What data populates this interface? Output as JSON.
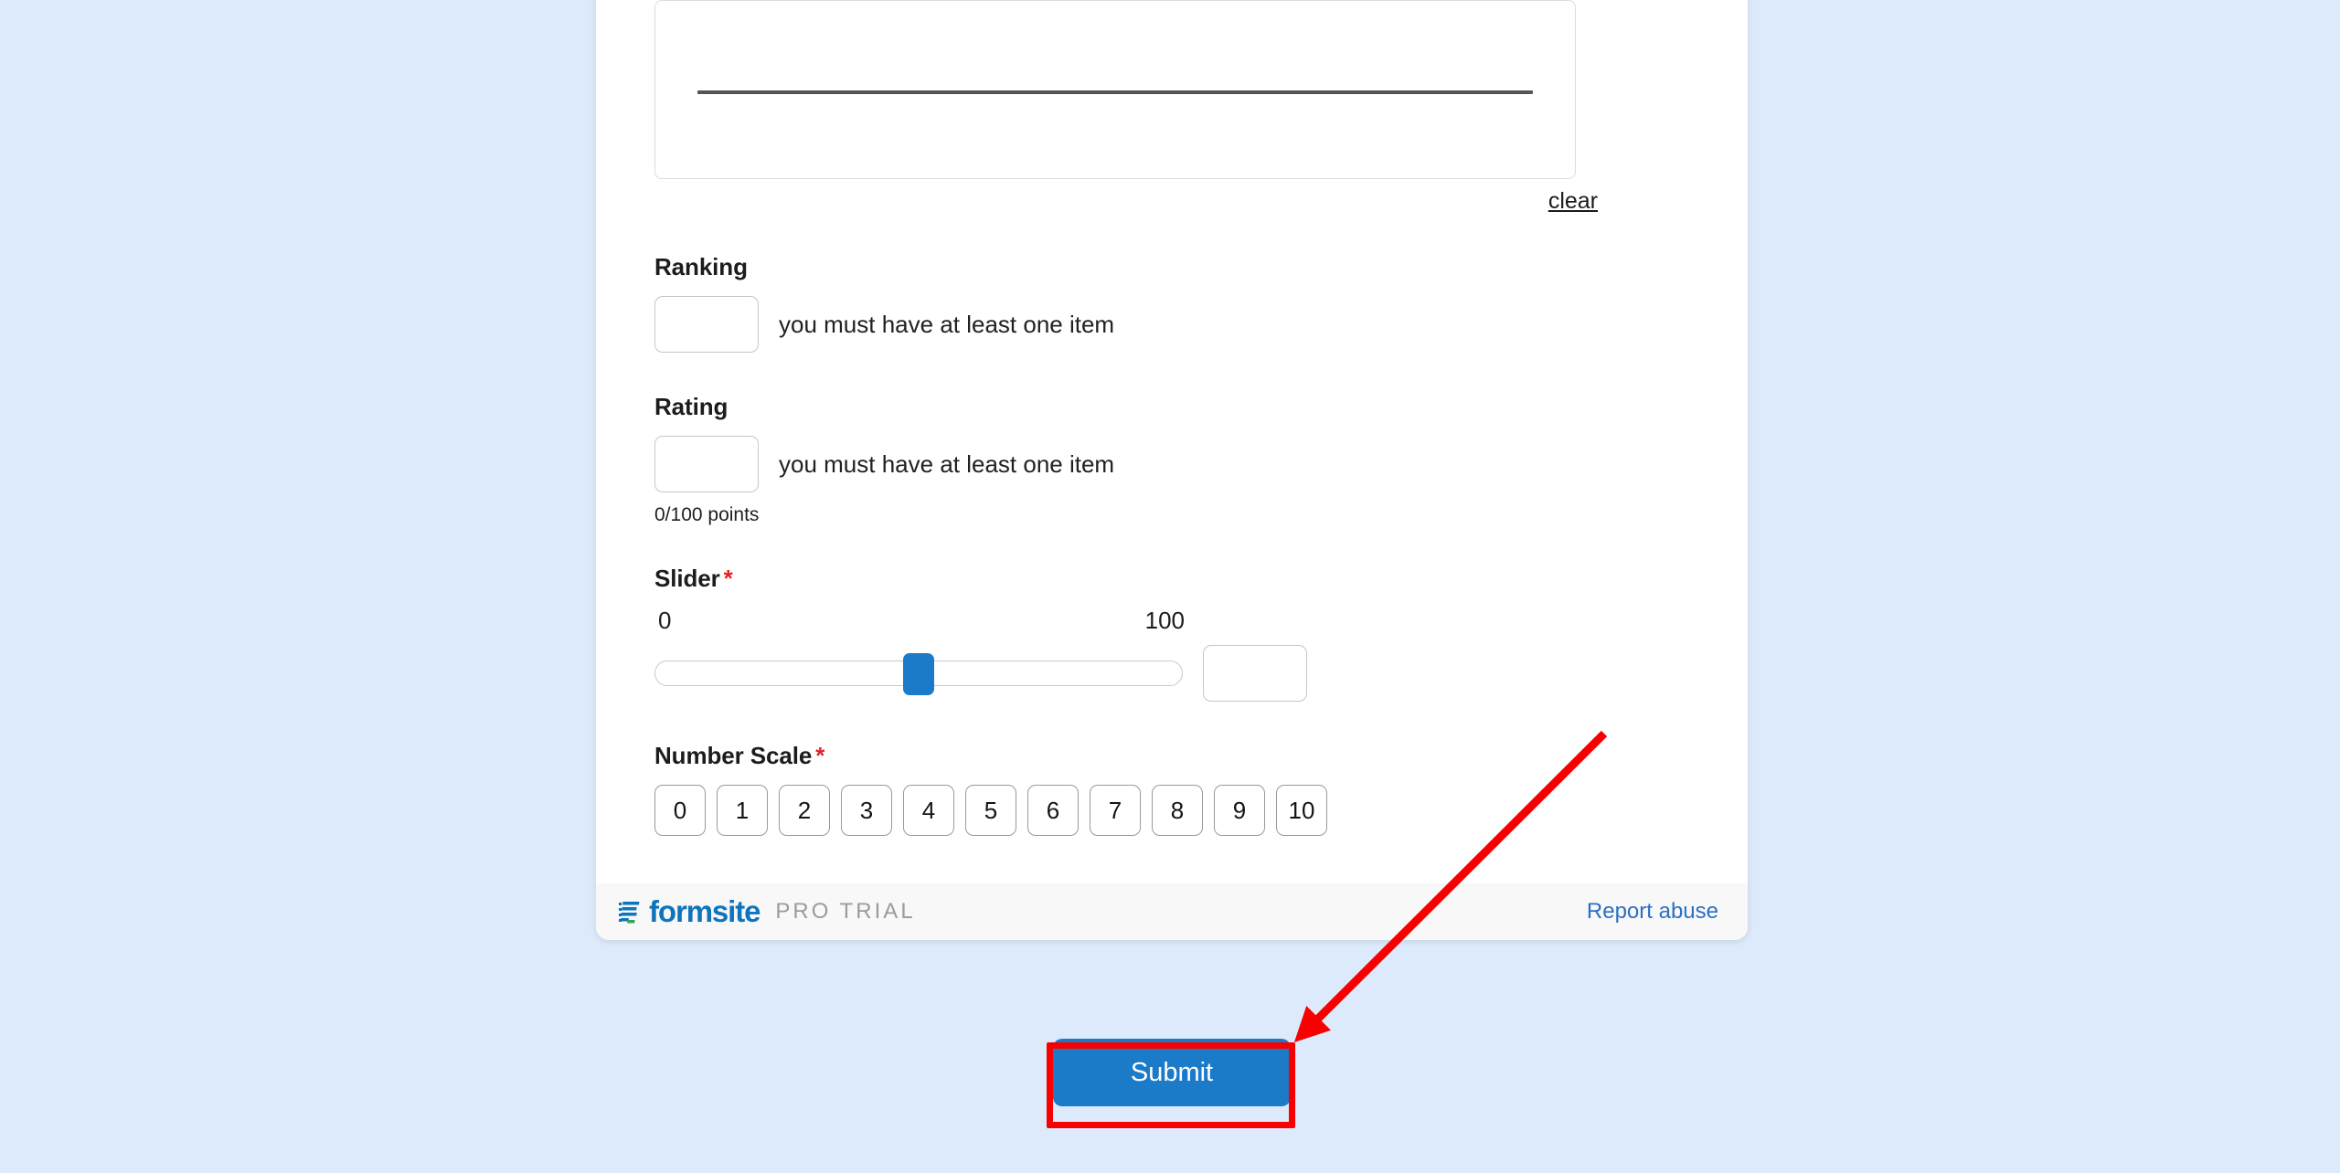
{
  "page": {
    "background_color": "#dceafb",
    "card_background": "#ffffff",
    "accent_color": "#1b7bc8",
    "required_color": "#e32222",
    "annotation_color": "#f80000"
  },
  "signature": {
    "clear_label": "clear"
  },
  "fields": {
    "ranking": {
      "label": "Ranking",
      "input_value": "",
      "message": "you must have at least one item"
    },
    "rating": {
      "label": "Rating",
      "input_value": "",
      "message": "you must have at least one item",
      "points_note": "0/100 points"
    },
    "slider": {
      "label": "Slider",
      "required_marker": "*",
      "min_label": "0",
      "max_label": "100",
      "value_percent": 50,
      "input_value": ""
    },
    "number_scale": {
      "label": "Number Scale",
      "required_marker": "*",
      "options": [
        "0",
        "1",
        "2",
        "3",
        "4",
        "5",
        "6",
        "7",
        "8",
        "9",
        "10"
      ]
    }
  },
  "footer": {
    "brand_name": "formsite",
    "plan_label": "PRO TRIAL",
    "report_abuse_label": "Report abuse"
  },
  "submit": {
    "label": "Submit"
  }
}
